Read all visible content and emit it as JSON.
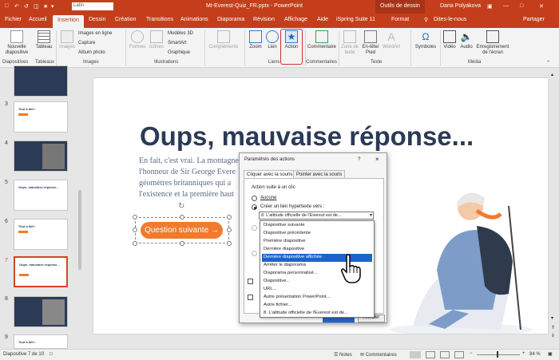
{
  "titlebar": {
    "autosave_font": "Latin",
    "filename": "Mt-Everest-Quiz_FR.pptx - PowerPoint",
    "context": "Outils de dessin",
    "user": "Daria Polyakova"
  },
  "tabs": [
    "Fichier",
    "Accueil",
    "Insertion",
    "Dessin",
    "Création",
    "Transitions",
    "Animations",
    "Diaporama",
    "Révision",
    "Affichage",
    "Aide",
    "iSpring Suite 11",
    "Format"
  ],
  "active_tab": "Insertion",
  "tell_me": "Dites-le-nous",
  "share": "Partager",
  "ribbon": {
    "new_slide": "Nouvelle diapositive",
    "table": "Tableau",
    "images": "Images",
    "online_images": "Images en ligne",
    "capture": "Capture",
    "album": "Album photo",
    "shapes": "Formes",
    "icons": "Icônes",
    "models3d": "Modèles 3D",
    "smartart": "SmartArt",
    "chart": "Graphique",
    "addins": "Compléments",
    "zoom": "Zoom",
    "link": "Lien",
    "action": "Action",
    "comment": "Commentaire",
    "textbox": "Zone de texte",
    "header_footer": "En-tête/ Pied",
    "wordart": "WordArt",
    "symbols": "Symboles",
    "video": "Vidéo",
    "audio": "Audio",
    "screen_record": "Enregistrement de l'écran",
    "groups": [
      "Diapositives",
      "Tableaux",
      "Images",
      "Illustrations",
      "Liens",
      "Commentaires",
      "Texte",
      "Média"
    ]
  },
  "thumbs": [
    {
      "num": "3",
      "title": "Tout à fait !"
    },
    {
      "num": "4",
      "title": ""
    },
    {
      "num": "5",
      "title": "Oups, mauvaise réponse..."
    },
    {
      "num": "6",
      "title": "Tout à fait !"
    },
    {
      "num": "7",
      "title": "Oups, mauvaise réponse..."
    },
    {
      "num": "8",
      "title": ""
    },
    {
      "num": "9",
      "title": "Tout à fait !"
    }
  ],
  "slide": {
    "heading": "Oups, mauvaise réponse...",
    "lines": [
      "En fait, c'est vrai. La montagne",
      "l'honneur de Sir George Evere",
      "géomètres britanniques qui a",
      "l'existence et la première haut"
    ],
    "button": "Question suivante →"
  },
  "dialog": {
    "title": "Paramètres des actions",
    "help": "?",
    "close": "×",
    "tabs": [
      "Cliquer avec la souris",
      "Pointer avec la souris"
    ],
    "group": "Action suite à un clic",
    "none": "Aucune",
    "hyperlink": "Créer un lien hypertexte vers :",
    "combo_value": "8. L'altitude officielle de l'Everest est de...",
    "cancel": "Annuler"
  },
  "dropdown": [
    "Diapositive suivante",
    "Diapositive précédente",
    "Première diapositive",
    "Dernière diapositive",
    "Dernière diapositive affichée",
    "Arrêter le diaporama",
    "Diaporama personnalisé...",
    "Diapositive...",
    "URL...",
    "Autre présentation PowerPoint...",
    "Autre fichier...",
    "8. L'altitude officielle de l'Everest est de..."
  ],
  "dropdown_selected": 4,
  "status": {
    "slide": "Diapositive 7 de 10",
    "notes": "Notes",
    "comments": "Commentaires",
    "zoom": "84 %"
  },
  "colors": {
    "accent": "#c43e1c",
    "orange": "#f07b2d",
    "heading": "#2b3a55",
    "select": "#1e64c8"
  }
}
